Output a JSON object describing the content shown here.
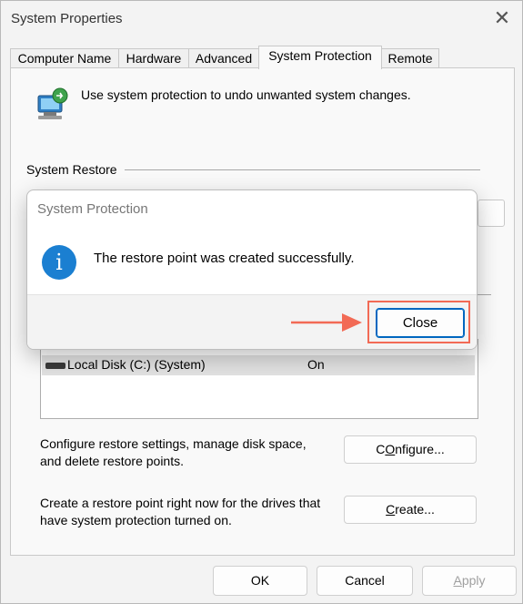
{
  "window": {
    "title": "System Properties",
    "close_glyph": "✕"
  },
  "tabs": [
    {
      "label": "Computer Name",
      "active": false
    },
    {
      "label": "Hardware",
      "active": false
    },
    {
      "label": "Advanced",
      "active": false
    },
    {
      "label": "System Protection",
      "active": true
    },
    {
      "label": "Remote",
      "active": false
    }
  ],
  "panel": {
    "intro_text": "Use system protection to undo unwanted system changes.",
    "system_restore_label": "System Restore",
    "drives": [
      {
        "name": "Local Disk (C:) (System)",
        "protection": "On"
      }
    ],
    "configure_desc_1": "Configure restore settings, manage disk space,",
    "configure_desc_2": "and delete restore points.",
    "configure_btn": {
      "accel": "O",
      "pre": "C",
      "post": "nfigure..."
    },
    "create_desc_1": "Create a restore point right now for the drives that",
    "create_desc_2": "have system protection turned on.",
    "create_btn": {
      "pre": "",
      "accel": "C",
      "post": "reate..."
    }
  },
  "footer": {
    "ok": "OK",
    "cancel": "Cancel",
    "apply": {
      "pre": "",
      "accel": "A",
      "post": "pply"
    }
  },
  "dialog": {
    "title": "System Protection",
    "icon_glyph": "i",
    "message": "The restore point was created successfully.",
    "close_label": "Close"
  },
  "colors": {
    "accent": "#0067c0",
    "highlight": "#f26a55",
    "info": "#1b7fd1"
  }
}
